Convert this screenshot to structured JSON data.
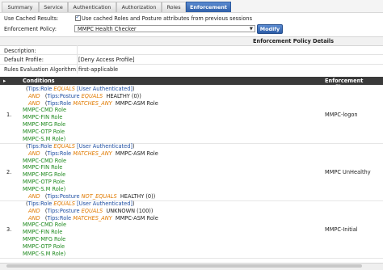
{
  "tabs": [
    {
      "label": "Summary"
    },
    {
      "label": "Service"
    },
    {
      "label": "Authentication"
    },
    {
      "label": "Authorization"
    },
    {
      "label": "Roles"
    },
    {
      "label": "Enforcement"
    }
  ],
  "use_cached": {
    "label": "Use Cached Results:",
    "checkbox_label": "Use cached Roles and Posture attributes from previous sessions"
  },
  "enforcement_policy": {
    "label": "Enforcement Policy:",
    "value": "MMPC Health Checker",
    "modify_label": "Modify"
  },
  "details_header": "Enforcement Policy Details",
  "details": {
    "description_label": "Description:",
    "description_value": "",
    "default_profile_label": "Default Profile:",
    "default_profile_value": "[Deny Access Profile]",
    "rules_algo_label": "Rules Evaluation Algorithm:",
    "rules_algo_value": "first-applicable"
  },
  "table": {
    "col_conditions": "Conditions",
    "col_profiles": "Enforcement Profiles"
  },
  "rules": [
    {
      "num": "1.",
      "profile": "MMPC-logon",
      "lines": [
        [
          [
            "blk",
            "("
          ],
          [
            "ent",
            "Tips:Role"
          ],
          [
            "sp",
            " "
          ],
          [
            "kw",
            "EQUALS"
          ],
          [
            "sp",
            " "
          ],
          [
            "ent",
            "[User Authenticated]"
          ],
          [
            "blk",
            ")"
          ]
        ],
        [
          [
            "kw",
            "AND"
          ],
          [
            "sp",
            "   ("
          ],
          [
            "ent",
            "Tips:Posture"
          ],
          [
            "sp",
            " "
          ],
          [
            "kw",
            "EQUALS"
          ],
          [
            "sp",
            "  "
          ],
          [
            "blk",
            "HEALTHY (0)"
          ],
          [
            "blk",
            ")"
          ]
        ],
        [
          [
            "kw",
            "AND"
          ],
          [
            "sp",
            "   ("
          ],
          [
            "ent",
            "Tips:Role"
          ],
          [
            "sp",
            " "
          ],
          [
            "kw",
            "MATCHES_ANY"
          ],
          [
            "sp",
            "  "
          ],
          [
            "blk",
            "MMPC-ASM Role"
          ]
        ],
        [
          [
            "val",
            "MMPC-CMD Role"
          ]
        ],
        [
          [
            "val",
            "MMPC-FIN Role"
          ]
        ],
        [
          [
            "val",
            "MMPC-MFG Role"
          ]
        ],
        [
          [
            "val",
            "MMPC-OTP Role"
          ]
        ],
        [
          [
            "val",
            "MMPC-S.M Role)"
          ]
        ]
      ]
    },
    {
      "num": "2.",
      "profile": "MMPC UnHealthy",
      "lines": [
        [
          [
            "blk",
            "("
          ],
          [
            "ent",
            "Tips:Role"
          ],
          [
            "sp",
            " "
          ],
          [
            "kw",
            "EQUALS"
          ],
          [
            "sp",
            " "
          ],
          [
            "ent",
            "[User Authenticated]"
          ],
          [
            "blk",
            ")"
          ]
        ],
        [
          [
            "kw",
            "AND"
          ],
          [
            "sp",
            "   ("
          ],
          [
            "ent",
            "Tips:Role"
          ],
          [
            "sp",
            " "
          ],
          [
            "kw",
            "MATCHES_ANY"
          ],
          [
            "sp",
            "  "
          ],
          [
            "blk",
            "MMPC-ASM Role"
          ]
        ],
        [
          [
            "val",
            "MMPC-CMD Role"
          ]
        ],
        [
          [
            "val",
            "MMPC-FIN Role"
          ]
        ],
        [
          [
            "val",
            "MMPC-MFG Role"
          ]
        ],
        [
          [
            "val",
            "MMPC-OTP Role"
          ]
        ],
        [
          [
            "val",
            "MMPC-S.M Role)"
          ]
        ],
        [
          [
            "kw",
            "AND"
          ],
          [
            "sp",
            "   ("
          ],
          [
            "ent",
            "Tips:Posture"
          ],
          [
            "sp",
            " "
          ],
          [
            "kw",
            "NOT_EQUALS"
          ],
          [
            "sp",
            "  "
          ],
          [
            "blk",
            "HEALTHY (0)"
          ],
          [
            "blk",
            ")"
          ]
        ]
      ]
    },
    {
      "num": "3.",
      "profile": "MMPC-Initial",
      "lines": [
        [
          [
            "blk",
            "("
          ],
          [
            "ent",
            "Tips:Role"
          ],
          [
            "sp",
            " "
          ],
          [
            "kw",
            "EQUALS"
          ],
          [
            "sp",
            " "
          ],
          [
            "ent",
            "[User Authenticated]"
          ],
          [
            "blk",
            ")"
          ]
        ],
        [
          [
            "kw",
            "AND"
          ],
          [
            "sp",
            "   ("
          ],
          [
            "ent",
            "Tips:Posture"
          ],
          [
            "sp",
            " "
          ],
          [
            "kw",
            "EQUALS"
          ],
          [
            "sp",
            "  "
          ],
          [
            "blk",
            "UNKNOWN (100)"
          ],
          [
            "blk",
            ")"
          ]
        ],
        [
          [
            "kw",
            "AND"
          ],
          [
            "sp",
            "   ("
          ],
          [
            "ent",
            "Tips:Role"
          ],
          [
            "sp",
            " "
          ],
          [
            "kw",
            "MATCHES_ANY"
          ],
          [
            "sp",
            "  "
          ],
          [
            "blk",
            "MMPC-ASM Role"
          ]
        ],
        [
          [
            "val",
            "MMPC-CMD Role"
          ]
        ],
        [
          [
            "val",
            "MMPC-FIN Role"
          ]
        ],
        [
          [
            "val",
            "MMPC-MFG Role"
          ]
        ],
        [
          [
            "val",
            "MMPC-OTP Role"
          ]
        ],
        [
          [
            "val",
            "MMPC-S.M Role)"
          ]
        ]
      ]
    }
  ]
}
